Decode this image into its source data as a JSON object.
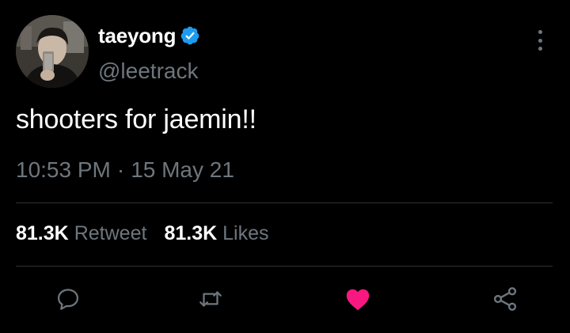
{
  "user": {
    "display_name": "taeyong",
    "handle": "@leetrack",
    "verified": true
  },
  "tweet": {
    "text": "shooters for jaemin!!",
    "time": "10:53 PM",
    "separator": "·",
    "date": "15 May 21"
  },
  "stats": {
    "retweets": {
      "count": "81.3K",
      "label": "Retweet"
    },
    "likes": {
      "count": "81.3K",
      "label": "Likes"
    }
  },
  "actions": {
    "reply": "reply-icon",
    "retweet": "retweet-icon",
    "like": "heart-icon",
    "share": "share-icon",
    "liked": true
  },
  "colors": {
    "background": "#000000",
    "text": "#ffffff",
    "secondary": "#6e767d",
    "divider": "#2f3336",
    "verified": "#1d9bf0",
    "like": "#f91880"
  }
}
